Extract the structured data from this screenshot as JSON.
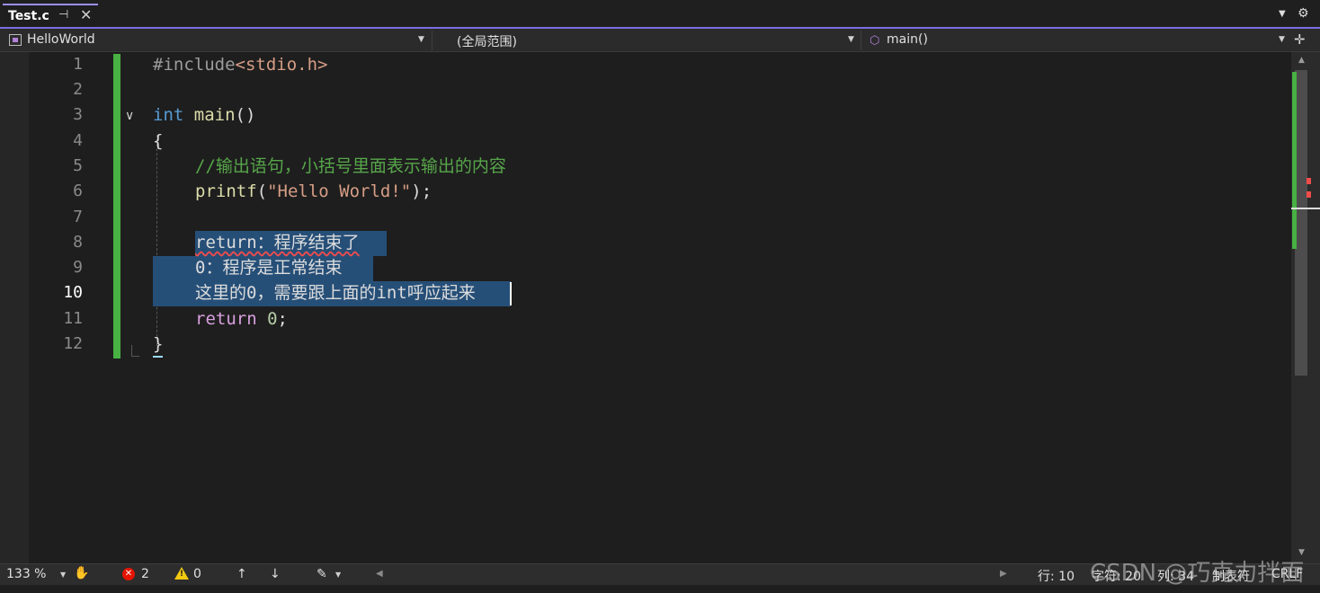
{
  "tab": {
    "title": "Test.c",
    "pin_icon": "pin-icon",
    "close_icon": "close-icon"
  },
  "navbar": {
    "project": "HelloWorld",
    "scope": "(全局范围)",
    "member": "main()"
  },
  "editor": {
    "line_numbers": [
      "1",
      "2",
      "3",
      "4",
      "5",
      "6",
      "7",
      "8",
      "9",
      "10",
      "11",
      "12"
    ],
    "current_line": "10",
    "code": {
      "l1_pp": "#include",
      "l1_inc": "<stdio.h>",
      "l3_kw": "int",
      "l3_fn": "main",
      "l3_rest": "()",
      "l4": "{",
      "l5_cmt": "//输出语句，小括号里面表示输出的内容",
      "l6_fn": "printf",
      "l6_open": "(",
      "l6_str": "\"Hello World!\"",
      "l6_close": ");",
      "l8": "return：程序结束了",
      "l9": "0：程序是正常结束",
      "l10": "这里的0，需要跟上面的int呼应起来",
      "l11_kw": "return",
      "l11_num": "0",
      "l11_end": ";",
      "l12": "}"
    }
  },
  "statusbar": {
    "zoom": "133 %",
    "errors": "2",
    "warnings": "0",
    "line": "行: 10",
    "char": "字符: 20",
    "col": "列: 34",
    "tabs": "制表符",
    "eol": "CRLF"
  },
  "watermark": "CSDN @巧克力拌面",
  "colors": {
    "accent": "#7a6ee0",
    "change_bar": "#48b144",
    "selection": "#264f78",
    "error": "#f14c4c"
  }
}
